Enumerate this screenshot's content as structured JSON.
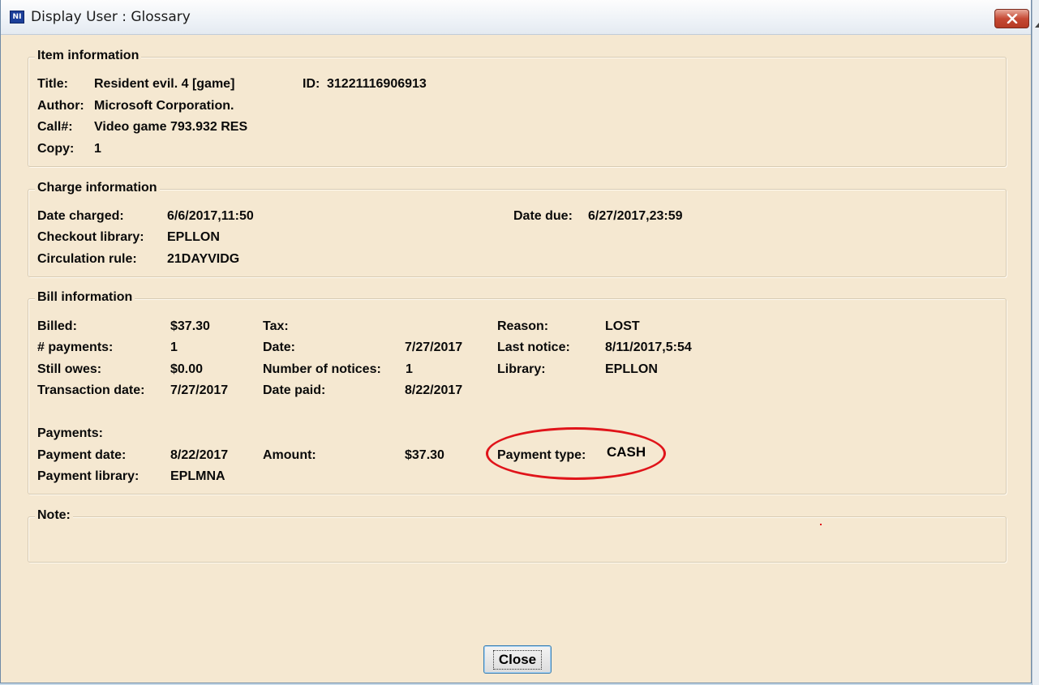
{
  "window": {
    "title": "Display User : Glossary",
    "icon_label": "NI",
    "close_icon": "close-x-icon"
  },
  "item_info": {
    "legend": "Item information",
    "title_label": "Title:",
    "title_value": "Resident evil. 4 [game]",
    "id_label": "ID:",
    "id_value": "31221116906913",
    "author_label": "Author:",
    "author_value": "Microsoft Corporation.",
    "call_label": "Call#:",
    "call_value": "Video game 793.932 RES",
    "copy_label": "Copy:",
    "copy_value": "1"
  },
  "charge_info": {
    "legend": "Charge information",
    "date_charged_label": "Date charged:",
    "date_charged_value": "6/6/2017,11:50",
    "date_due_label": "Date due:",
    "date_due_value": "6/27/2017,23:59",
    "checkout_library_label": "Checkout library:",
    "checkout_library_value": "EPLLON",
    "circ_rule_label": "Circulation rule:",
    "circ_rule_value": "21DAYVIDG"
  },
  "bill_info": {
    "legend": "Bill information",
    "billed_label": "Billed:",
    "billed_value": "$37.30",
    "tax_label": "Tax:",
    "tax_value": "",
    "reason_label": "Reason:",
    "reason_value": "LOST",
    "payments_count_label": "# payments:",
    "payments_count_value": "1",
    "date_label": "Date:",
    "date_value": "7/27/2017",
    "last_notice_label": "Last notice:",
    "last_notice_value": "8/11/2017,5:54",
    "still_owes_label": "Still owes:",
    "still_owes_value": "$0.00",
    "num_notices_label": "Number of notices:",
    "num_notices_value": "1",
    "library_label": "Library:",
    "library_value": "EPLLON",
    "transaction_date_label": "Transaction date:",
    "transaction_date_value": "7/27/2017",
    "date_paid_label": "Date paid:",
    "date_paid_value": "8/22/2017",
    "payments_heading": "Payments:",
    "payment_date_label": "Payment date:",
    "payment_date_value": "8/22/2017",
    "amount_label": "Amount:",
    "amount_value": "$37.30",
    "payment_type_label": "Payment type:",
    "payment_type_value": "CASH",
    "payment_library_label": "Payment library:",
    "payment_library_value": "EPLMNA"
  },
  "note": {
    "legend": "Note:"
  },
  "buttons": {
    "close_label": "Close"
  },
  "colors": {
    "background": "#f5e8d1",
    "highlight_circle": "#e0141a"
  }
}
